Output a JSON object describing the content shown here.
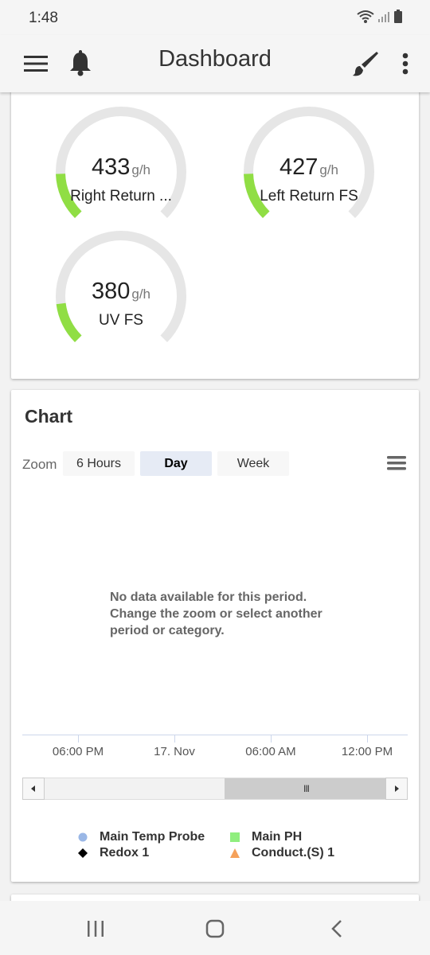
{
  "status_bar": {
    "time": "1:48",
    "icons": [
      "wifi-icon",
      "signal-icon",
      "battery-icon"
    ]
  },
  "app_bar": {
    "title": "Dashboard",
    "icons": [
      "menu-icon",
      "bell-icon",
      "brush-icon",
      "more-vertical-icon"
    ]
  },
  "gauges": [
    {
      "value": "433",
      "unit": "g/h",
      "label": "Right Return ...",
      "fill": 0.16
    },
    {
      "value": "427",
      "unit": "g/h",
      "label": "Left Return FS",
      "fill": 0.16
    },
    {
      "value": "380",
      "unit": "g/h",
      "label": "UV FS",
      "fill": 0.14
    }
  ],
  "gauge_colors": {
    "track": "#e6e6e6",
    "fill": "#90de44"
  },
  "chart": {
    "title": "Chart",
    "zoom_label": "Zoom",
    "zoom_options": [
      "6 Hours",
      "Day",
      "Week"
    ],
    "zoom_selected": "Day",
    "no_data_message": "No data available for this period. Change the zoom or select another period or category.",
    "x_ticks": [
      "06:00 PM",
      "17. Nov",
      "06:00 AM",
      "12:00 PM"
    ],
    "navigator_handle": "III",
    "legend": [
      {
        "name": "Main Temp Probe",
        "symbol": "circle",
        "color": "#9ab7e6"
      },
      {
        "name": "Main PH",
        "symbol": "square",
        "color": "#90ee7e"
      },
      {
        "name": "Redox 1",
        "symbol": "diamond",
        "color": "#000000"
      },
      {
        "name": "Conduct.(S) 1",
        "symbol": "triangle",
        "color": "#f5a15a"
      }
    ]
  },
  "chart_data": {
    "type": "line",
    "title": "",
    "x": [
      "06:00 PM",
      "17. Nov",
      "06:00 AM",
      "12:00 PM"
    ],
    "series": [
      {
        "name": "Main Temp Probe",
        "values": []
      },
      {
        "name": "Main PH",
        "values": []
      },
      {
        "name": "Redox 1",
        "values": []
      },
      {
        "name": "Conduct.(S) 1",
        "values": []
      }
    ],
    "legend": "bottom-center",
    "grid": false
  },
  "system_nav": {
    "icons": [
      "recent-apps-icon",
      "home-icon",
      "back-icon"
    ]
  }
}
